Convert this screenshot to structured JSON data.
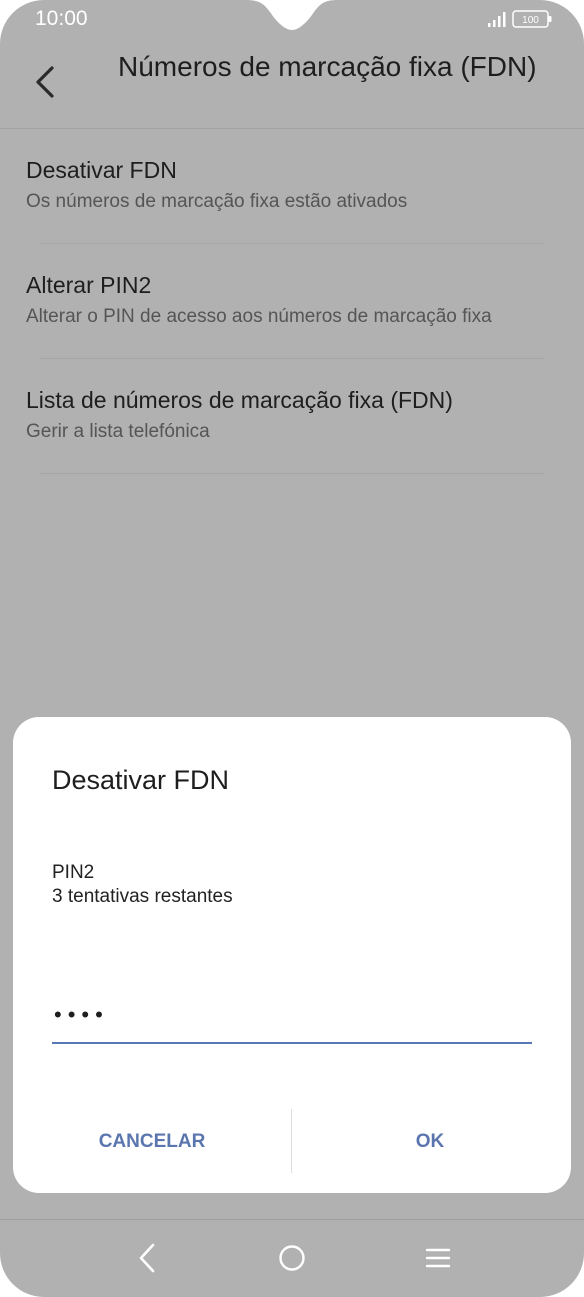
{
  "status_bar": {
    "time": "10:00",
    "signal_icon": "signal-bars-icon",
    "battery_level": "100"
  },
  "app_bar": {
    "back_icon": "back-arrow-icon",
    "title": "Números de marcação fixa (FDN)"
  },
  "settings_items": [
    {
      "title": "Desativar FDN",
      "subtitle": "Os números de marcação fixa estão ativados"
    },
    {
      "title": "Alterar PIN2",
      "subtitle": "Alterar o PIN de acesso aos números de marcação fixa"
    },
    {
      "title": "Lista de números de marcação fixa (FDN)",
      "subtitle": "Gerir a lista telefónica"
    }
  ],
  "dialog": {
    "title": "Desativar FDN",
    "field_label": "PIN2",
    "attempts_text": "3 tentativas restantes",
    "pin_masked": "••••",
    "cancel_label": "CANCELAR",
    "ok_label": "OK"
  },
  "nav_bar": {
    "back_icon": "nav-back-icon",
    "home_icon": "home-icon",
    "menu_icon": "menu-icon"
  },
  "colors": {
    "scrim": "#b1b1b1",
    "accent": "#5b76ae",
    "dialog_bg": "#ffffff"
  }
}
